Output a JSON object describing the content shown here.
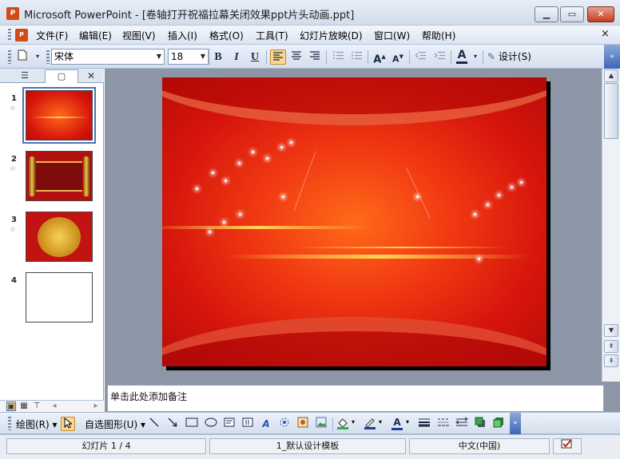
{
  "window": {
    "app_icon_label": "P",
    "title": "Microsoft PowerPoint - [卷轴打开祝福拉幕关闭效果ppt片头动画.ppt]",
    "min_symbol": "▁",
    "max_symbol": "▭",
    "close_symbol": "✕"
  },
  "menu": {
    "items": [
      "文件(F)",
      "编辑(E)",
      "视图(V)",
      "插入(I)",
      "格式(O)",
      "工具(T)",
      "幻灯片放映(D)",
      "窗口(W)",
      "帮助(H)"
    ],
    "close_symbol": "×",
    "doc_icon_label": "P"
  },
  "format_toolbar": {
    "font_name": "宋体",
    "font_size": "18",
    "bold": "B",
    "italic": "I",
    "underline": "U",
    "design_label": "设计(S)"
  },
  "panel": {
    "tab_outline_icon": "☰",
    "tab_slides_icon": "▢",
    "close_symbol": "✕",
    "slides": [
      {
        "number": "1",
        "star": "☆"
      },
      {
        "number": "2",
        "star": "☆"
      },
      {
        "number": "3",
        "star": "☆"
      },
      {
        "number": "4",
        "star": ""
      }
    ],
    "view_icons": [
      "▣",
      "▦",
      "⊤"
    ]
  },
  "notes": {
    "placeholder": "单击此处添加备注"
  },
  "draw_toolbar": {
    "draw_label": "绘图(R)",
    "autoshape_label": "自选图形(U)"
  },
  "status": {
    "slide_info": "幻灯片 1 / 4",
    "design_template": "1_默认设计模板",
    "language": "中文(中国)"
  },
  "colors": {
    "slide_red": "#d6150c",
    "accent_gold": "#fbd88c"
  }
}
